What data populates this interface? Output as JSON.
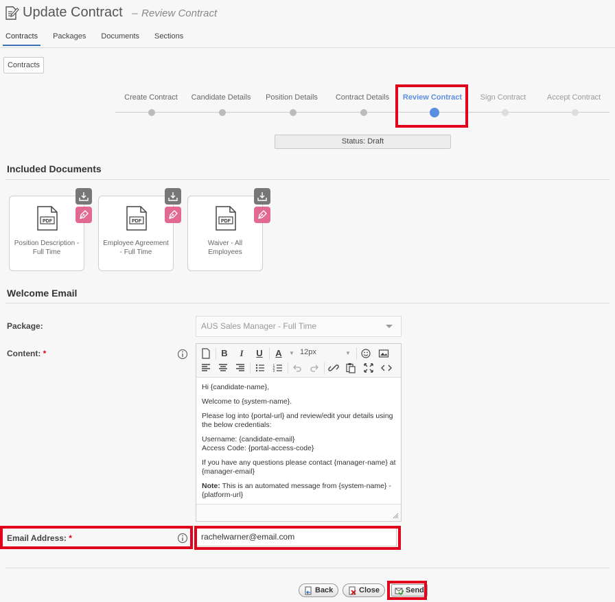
{
  "header": {
    "title": "Update Contract",
    "separator": "–",
    "subtitle": "Review Contract"
  },
  "nav": {
    "tabs": [
      "Contracts",
      "Packages",
      "Documents",
      "Sections"
    ],
    "active_tab": "Contracts"
  },
  "contracts_button": "Contracts",
  "stepper": {
    "steps": [
      {
        "label": "Create Contract",
        "state": "done"
      },
      {
        "label": "Candidate Details",
        "state": "done"
      },
      {
        "label": "Position Details",
        "state": "done"
      },
      {
        "label": "Contract Details",
        "state": "done"
      },
      {
        "label": "Review Contract",
        "state": "current"
      },
      {
        "label": "Sign Contract",
        "state": "future"
      },
      {
        "label": "Accept Contract",
        "state": "future"
      }
    ],
    "status": "Status: Draft"
  },
  "documents": {
    "heading": "Included Documents",
    "pdf_label": "PDF",
    "items": [
      {
        "name": "Position Description - Full Time"
      },
      {
        "name": "Employee Agreement - Full Time"
      },
      {
        "name": "Waiver - All Employees"
      }
    ]
  },
  "welcome_email": {
    "heading": "Welcome Email",
    "package_label": "Package:",
    "package_value": "AUS Sales Manager - Full Time",
    "content_label": "Content:",
    "required_mark": "*",
    "font_size": "12px",
    "content": {
      "greeting": "Hi {candidate-name},",
      "welcome": "Welcome to {system-name}.",
      "login": "Please log into {portal-url} and review/edit your details using the below credentials:",
      "username": "Username: {candidate-email}",
      "access_code": "Access Code: {portal-access-code}",
      "questions": "If you have any questions please contact {manager-name} at {manager-email}",
      "note_label": "Note:",
      "note_text": " This is an automated message from {system-name} - {platform-url}"
    },
    "email_label": "Email Address:",
    "email_value": "rachelwarner@email.com"
  },
  "footer": {
    "back": "Back",
    "close": "Close",
    "send": "Send"
  },
  "colors": {
    "highlight": "#e0001b",
    "accent": "#5c8fe0",
    "sign_button": "#e26a92",
    "download_button": "#777777"
  }
}
